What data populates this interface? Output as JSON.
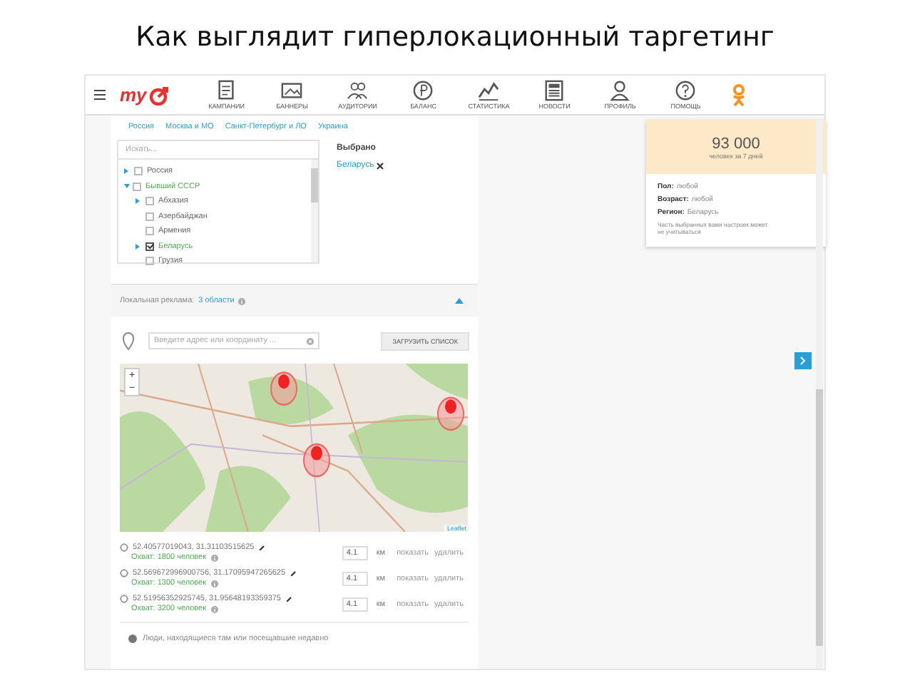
{
  "slide_title": "Как выглядит гиперлокационный таргетинг",
  "nav": {
    "logo": "my",
    "items": [
      {
        "label": "КАМПАНИИ"
      },
      {
        "label": "БАННЕРЫ"
      },
      {
        "label": "АУДИТОРИИ"
      },
      {
        "label": "БАЛАНС"
      },
      {
        "label": "СТАТИСТИКА"
      },
      {
        "label": "НОВОСТИ"
      },
      {
        "label": "ПРОФИЛЬ"
      },
      {
        "label": "ПОМОЩЬ"
      }
    ]
  },
  "region_links": [
    "Россия",
    "Москва и МО",
    "Санкт-Петербург и ЛО",
    "Украина"
  ],
  "search": {
    "placeholder": "Искать..."
  },
  "tree": [
    {
      "label": "Россия",
      "checked": false,
      "highlighted": false,
      "expanded": false
    },
    {
      "label": "Бывший СССР",
      "checked": false,
      "highlighted": true,
      "expanded": true,
      "children": [
        {
          "label": "Абхазия",
          "checked": false,
          "highlighted": false,
          "expanded": false
        },
        {
          "label": "Азербайджан",
          "checked": false,
          "highlighted": false
        },
        {
          "label": "Армения",
          "checked": false,
          "highlighted": false
        },
        {
          "label": "Беларусь",
          "checked": true,
          "highlighted": true,
          "expanded": false
        },
        {
          "label": "Грузия",
          "checked": false,
          "highlighted": false
        }
      ]
    }
  ],
  "selected": {
    "title": "Выбрано",
    "items": [
      "Беларусь"
    ]
  },
  "local_ads": {
    "label": "Локальная реклама:",
    "count": "3 области",
    "expanded": true
  },
  "address": {
    "placeholder": "Введите адрес или координату ..."
  },
  "upload_button": "ЗАГРУЗИТЬ СПИСОК",
  "map": {
    "zoom_in": "+",
    "zoom_out": "−",
    "attribution": "Leaflet"
  },
  "points": [
    {
      "coords": "52.40577019043,  31.31103515625",
      "radius": "4.1",
      "unit": "км",
      "show": "показать",
      "delete": "удалить",
      "coverage": "Охват: 1800 человек"
    },
    {
      "coords": "52.569672996900756,  31.17095947265625",
      "radius": "4.1",
      "unit": "км",
      "show": "показать",
      "delete": "удалить",
      "coverage": "Охват: 1300 человек"
    },
    {
      "coords": "52.51956352925745,  31.95648193359375",
      "radius": "4.1",
      "unit": "км",
      "show": "показать",
      "delete": "удалить",
      "coverage": "Охват: 3200 человек"
    }
  ],
  "audience_option": {
    "label": "Люди, находящиеся там или посещавшие недавно",
    "selected": true
  },
  "summary": {
    "count": "93 000",
    "period": "человек за 7 дней",
    "rows": [
      {
        "label": "Пол:",
        "value": "любой"
      },
      {
        "label": "Возраст:",
        "value": "любой"
      },
      {
        "label": "Регион:",
        "value": "Беларусь"
      }
    ],
    "note": "Часть выбранных вами настроек может не учитываться"
  }
}
